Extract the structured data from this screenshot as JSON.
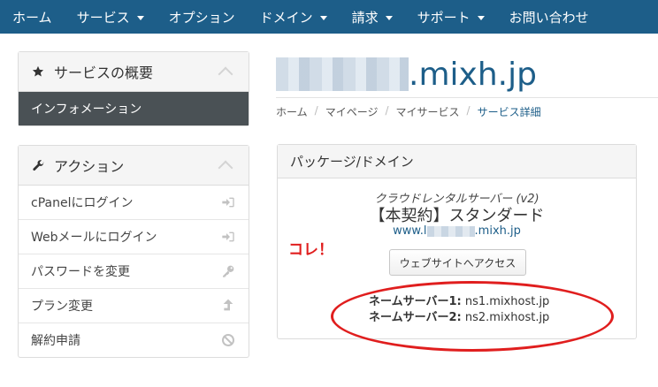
{
  "nav": {
    "items": [
      {
        "label": "ホーム",
        "dropdown": false
      },
      {
        "label": "サービス",
        "dropdown": true
      },
      {
        "label": "オプション",
        "dropdown": false
      },
      {
        "label": "ドメイン",
        "dropdown": true
      },
      {
        "label": "請求",
        "dropdown": true
      },
      {
        "label": "サポート",
        "dropdown": true
      },
      {
        "label": "お問い合わせ",
        "dropdown": false
      }
    ]
  },
  "sidebar": {
    "overview": {
      "title": "サービスの概要",
      "icon": "star-icon",
      "active_item": "インフォメーション"
    },
    "actions": {
      "title": "アクション",
      "icon": "wrench-icon",
      "items": [
        {
          "label": "cPanelにログイン",
          "icon": "sign-in-icon"
        },
        {
          "label": "Webメールにログイン",
          "icon": "sign-in-icon"
        },
        {
          "label": "パスワードを変更",
          "icon": "key-icon"
        },
        {
          "label": "プラン変更",
          "icon": "arrow-up-icon"
        },
        {
          "label": "解約申請",
          "icon": "ban-icon"
        }
      ]
    }
  },
  "main": {
    "domain_suffix": ".mixh.jp",
    "breadcrumb": [
      "ホーム",
      "マイページ",
      "マイサービス",
      "サービス詳細"
    ],
    "package": {
      "header": "パッケージ/ドメイン",
      "product": "クラウドレンタルサーバー (v2)",
      "plan": "【本契約】スタンダード",
      "domain_prefix": "www.l",
      "domain_suffix": ".mixh.jp",
      "visit_button": "ウェブサイトへアクセス",
      "ns1_label": "ネームサーバー1:",
      "ns1_value": " ns1.mixhost.jp",
      "ns2_label": "ネームサーバー2:",
      "ns2_value": " ns2.mixhost.jp"
    },
    "annotation": "コレ！"
  },
  "colors": {
    "nav_bg": "#1d5e89",
    "accent": "#1d5e89",
    "active_item_bg": "#4a5155",
    "annotation": "#e01e1e"
  }
}
